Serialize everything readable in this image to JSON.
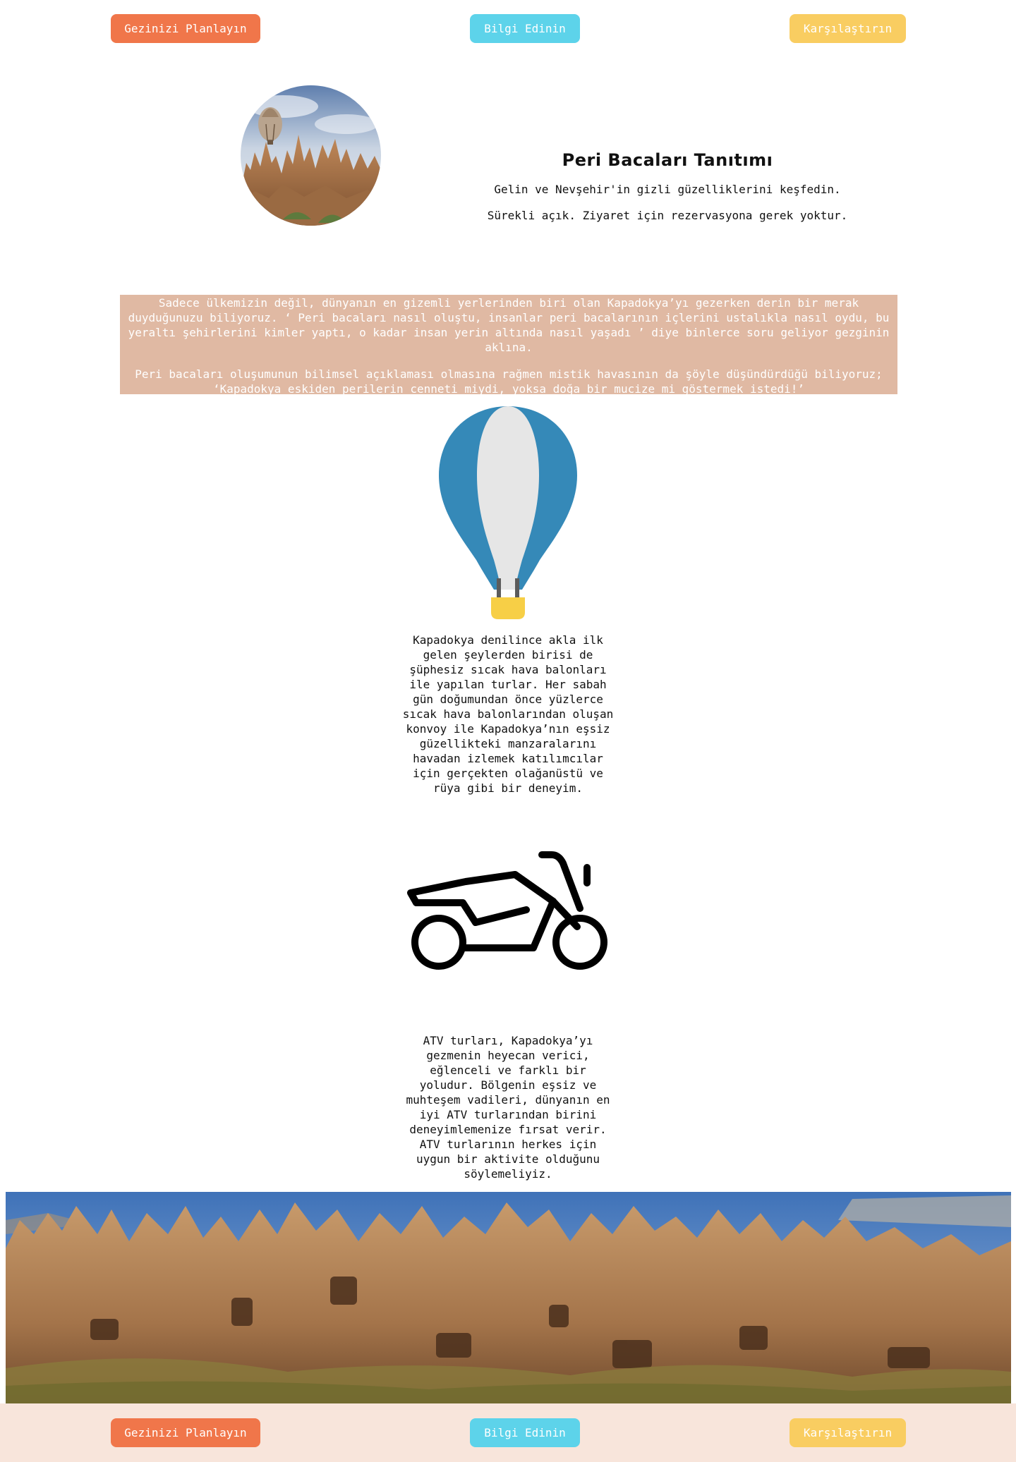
{
  "nav": {
    "plan_label": "Gezinizi Planlayın",
    "info_label": "Bilgi Edinin",
    "compare_label": "Karşılaştırın"
  },
  "colors": {
    "plan": "#f0764a",
    "info": "#5dd3ea",
    "compare": "#f9cd61",
    "story_bg": "#e0b9a3",
    "footer_bg": "#f8e5db",
    "balloon_blue": "#3589b8",
    "balloon_white": "#e6e6e6",
    "basket": "#f7cf46"
  },
  "intro": {
    "title": "Peri Bacaları Tanıtımı",
    "line1": "Gelin ve Nevşehir'in gizli güzelliklerini keşfedin.",
    "line2": "Sürekli açık. Ziyaret için rezervasyona gerek yoktur."
  },
  "story": {
    "paragraph1": "Sadece ülkemizin değil, dünyanın en gizemli yerlerinden biri olan Kapadokya’yı gezerken derin bir merak duyduğunuzu biliyoruz. ‘ Peri bacaları nasıl oluştu, insanlar peri bacalarının içlerini ustalıkla nasıl oydu, bu yeraltı şehirlerini kimler yaptı, o kadar insan yerin altında nasıl yaşadı ’ diye binlerce soru geliyor gezginin aklına.",
    "paragraph2": "Peri bacaları oluşumunun bilimsel açıklaması olmasına rağmen mistik havasının da şöyle düşündürdüğü biliyoruz; ‘Kapadokya eskiden perilerin cenneti miydi, yoksa doğa bir mucize mi göstermek istedi!’"
  },
  "balloon": {
    "icon": "hot-air-balloon-icon",
    "text": "Kapadokya denilince akla ilk gelen şeylerden birisi de şüphesiz sıcak hava balonları ile yapılan turlar. Her sabah gün doğumundan önce yüzlerce sıcak hava balonlarından oluşan konvoy ile Kapadokya’nın eşsiz güzellikteki manzaralarını havadan izlemek katılımcılar için gerçekten olağanüstü ve rüya gibi bir deneyim."
  },
  "atv": {
    "icon": "atv-icon",
    "text": "ATV turları, Kapadokya’yı gezmenin heyecan verici, eğlenceli ve farklı bir yoludur. Bölgenin eşsiz ve muhteşem vadileri, dünyanın en iyi ATV turlarından birini deneyimlemenize fırsat verir. ATV turlarının herkes için uygun bir aktivite olduğunu söylemeliyiz."
  }
}
